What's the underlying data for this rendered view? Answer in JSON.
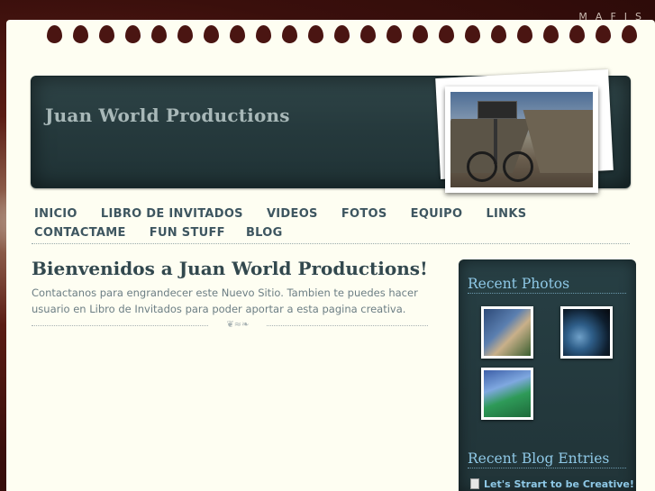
{
  "corner_text": "MAFIS",
  "header": {
    "site_title": "Juan World Productions"
  },
  "nav": {
    "items": [
      {
        "label": "INICIO"
      },
      {
        "label": "LIBRO DE INVITADOS"
      },
      {
        "label": "VIDEOS"
      },
      {
        "label": "FOTOS"
      },
      {
        "label": "EQUIPO"
      },
      {
        "label": "LINKS"
      },
      {
        "label": "CONTACTAME"
      },
      {
        "label": "FUN STUFF"
      },
      {
        "label": "BLOG"
      }
    ]
  },
  "main": {
    "title": "Bienvenidos a Juan World Productions!",
    "text": "Contactanos para engrandecer este Nuevo Sitio. Tambien te puedes hacer usuario en Libro de Invitados para poder aportar a esta pagina creativa."
  },
  "sidebar": {
    "recent_photos_heading": "Recent Photos",
    "recent_blog_heading": "Recent Blog Entries",
    "blog_entries": [
      {
        "title": "Let's Strart to be Creative!"
      }
    ]
  },
  "colors": {
    "paper": "#fefef2",
    "header_board": "#25393c",
    "nav_text": "#3e5660",
    "sidebar_heading": "#8ec8e6"
  }
}
